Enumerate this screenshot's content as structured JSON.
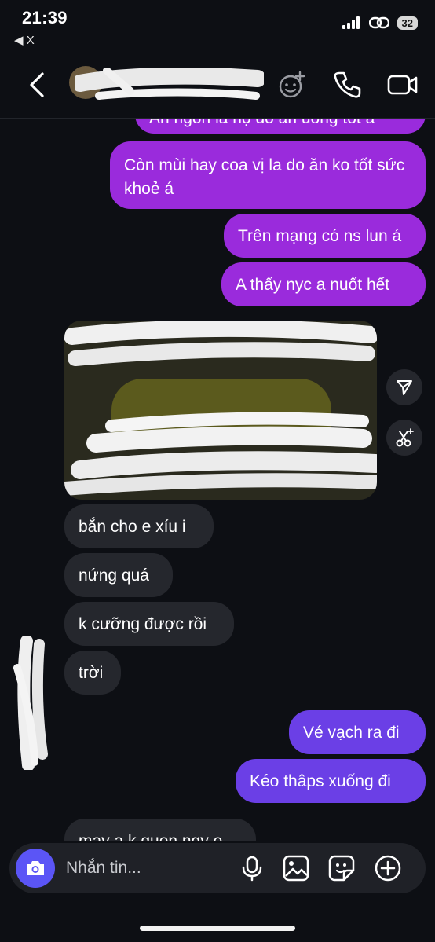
{
  "status_bar": {
    "time": "21:39",
    "back_app": "◀ X",
    "battery": "32"
  },
  "header": {
    "back_icon": "chevron-left-icon",
    "icons": [
      "emoji-add-icon",
      "phone-icon",
      "video-icon"
    ]
  },
  "messages": [
    {
      "side": "sent",
      "text": "Ăn ngon là nọ do ăn uống tốt á"
    },
    {
      "side": "sent",
      "text": "Còn mùi hay coa vị la do ăn ko tốt sức khoẻ á"
    },
    {
      "side": "sent",
      "text": "Trên mạng có ns lun á"
    },
    {
      "side": "sent",
      "text": "A thấy nyc a nuốt hết"
    },
    {
      "side": "recv",
      "text": "bắn cho e xíu i"
    },
    {
      "side": "recv",
      "text": "nứng quá"
    },
    {
      "side": "recv",
      "text": "k cưỡng được rồi"
    },
    {
      "side": "recv",
      "text": "trời"
    },
    {
      "side": "sent",
      "text": "Vé vạch ra đi"
    },
    {
      "side": "sent",
      "text": "Kéo thâps xuống đi"
    },
    {
      "side": "recv",
      "text": "may a k quen ngy e"
    }
  ],
  "composer": {
    "placeholder": "Nhắn tin...",
    "icons": [
      "camera-icon",
      "microphone-icon",
      "image-icon",
      "sticker-icon",
      "plus-icon"
    ]
  },
  "colors": {
    "background": "#0d0f14",
    "sent_bubble": "#9a2bdc",
    "sent_bubble_2": "#6b3fe6",
    "received_bubble": "#25272d",
    "camera_button": "#5b55f6"
  }
}
